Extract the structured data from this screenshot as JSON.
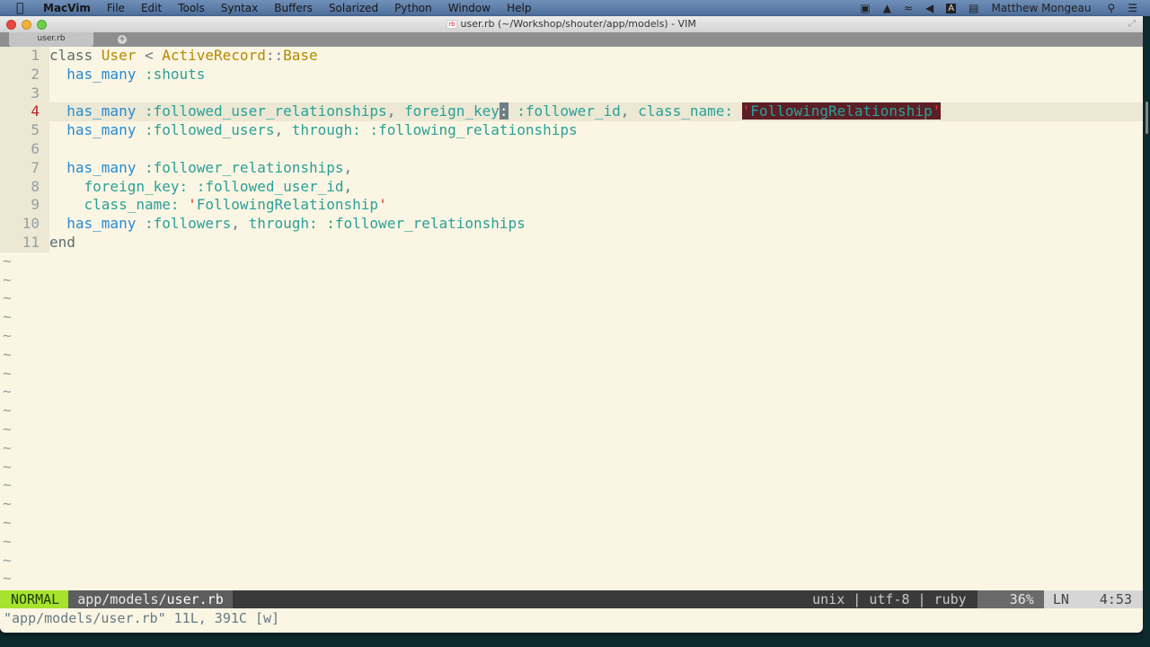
{
  "menubar": {
    "app_name": "MacVim",
    "items": [
      "File",
      "Edit",
      "Tools",
      "Syntax",
      "Buffers",
      "Solarized",
      "Python",
      "Window",
      "Help"
    ],
    "status_icons": [
      "facetime-camera-icon",
      "airplay-icon",
      "wifi-icon",
      "volume-icon",
      "input-source-icon",
      "battery-icon"
    ],
    "user_name": "Matthew Mongeau"
  },
  "window": {
    "title": "user.rb (~/Workshop/shouter/app/models) - VIM",
    "title_file_badge": "rb",
    "tab_label": "user.rb"
  },
  "editor": {
    "current_line": 4,
    "lines": [
      {
        "n": "1",
        "tokens": [
          {
            "t": "class ",
            "c": "kw"
          },
          {
            "t": "User",
            "c": "const"
          },
          {
            "t": " < ",
            "c": "plain"
          },
          {
            "t": "ActiveRecord",
            "c": "const"
          },
          {
            "t": "::",
            "c": "plain"
          },
          {
            "t": "Base",
            "c": "const"
          }
        ]
      },
      {
        "n": "2",
        "tokens": [
          {
            "t": "  has_many ",
            "c": "fn"
          },
          {
            "t": ":shouts",
            "c": "sym"
          }
        ]
      },
      {
        "n": "3",
        "tokens": []
      },
      {
        "n": "4",
        "tokens": [
          {
            "t": "  has_many ",
            "c": "fn"
          },
          {
            "t": ":followed_user_relationships",
            "c": "sym"
          },
          {
            "t": ", ",
            "c": "plain"
          },
          {
            "t": "foreign_key",
            "c": "sym"
          },
          {
            "t": ":",
            "c": "cursor"
          },
          {
            "t": " :follower_id",
            "c": "sym"
          },
          {
            "t": ", ",
            "c": "plain"
          },
          {
            "t": "class_name: ",
            "c": "sym"
          },
          {
            "t": "'FollowingRelationship'",
            "c": "search"
          }
        ]
      },
      {
        "n": "5",
        "tokens": [
          {
            "t": "  has_many ",
            "c": "fn"
          },
          {
            "t": ":followed_users",
            "c": "sym"
          },
          {
            "t": ", ",
            "c": "plain"
          },
          {
            "t": "through: :following_relationships",
            "c": "sym"
          }
        ]
      },
      {
        "n": "6",
        "tokens": []
      },
      {
        "n": "7",
        "tokens": [
          {
            "t": "  has_many ",
            "c": "fn"
          },
          {
            "t": ":follower_relationships",
            "c": "sym"
          },
          {
            "t": ",",
            "c": "plain"
          }
        ]
      },
      {
        "n": "8",
        "tokens": [
          {
            "t": "    foreign_key: :followed_user_id",
            "c": "sym"
          },
          {
            "t": ",",
            "c": "plain"
          }
        ]
      },
      {
        "n": "9",
        "tokens": [
          {
            "t": "    class_name: ",
            "c": "sym"
          },
          {
            "t": "'FollowingRelationship'",
            "c": "strq"
          }
        ]
      },
      {
        "n": "10",
        "tokens": [
          {
            "t": "  has_many ",
            "c": "fn"
          },
          {
            "t": ":followers",
            "c": "sym"
          },
          {
            "t": ", ",
            "c": "plain"
          },
          {
            "t": "through: :follower_relationships",
            "c": "sym"
          }
        ]
      },
      {
        "n": "11",
        "tokens": [
          {
            "t": "end",
            "c": "kw"
          }
        ]
      }
    ],
    "tilde_count": 18,
    "tilde_char": "~"
  },
  "statusline": {
    "mode": "NORMAL",
    "path_dir": "app/models/",
    "path_file": "user.rb",
    "fileformat": "unix",
    "encoding": "utf-8",
    "filetype": "ruby",
    "separator": "|",
    "percent": "36%",
    "ln_label": "LN",
    "position": "4:53"
  },
  "cmdline": "\"app/models/user.rb\" 11L, 391C [w]",
  "colors": {
    "background": "#fbf5e3",
    "mode_normal": "#a6e22e",
    "search_highlight": "#5c1f26"
  }
}
